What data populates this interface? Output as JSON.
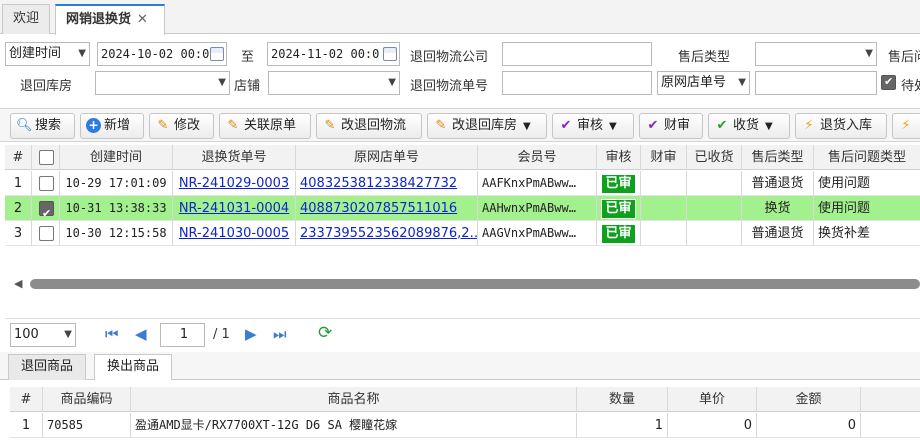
{
  "tabs": [
    {
      "label": "欢迎"
    },
    {
      "label": "网销退换货",
      "close": "✕"
    }
  ],
  "filters": {
    "date_type": "创建时间",
    "date_from": "2024-10-02 00:0",
    "to_label": "至",
    "date_to": "2024-11-02 00:0",
    "return_logistics_company_label": "退回物流公司",
    "return_logistics_company_value": "",
    "after_sale_type_label": "售后类型",
    "after_sale_type_value": "",
    "after_sale_issue_label": "售后问",
    "return_warehouse_label": "退回库房",
    "return_warehouse_value": "",
    "store_label": "店铺",
    "store_value": "",
    "return_tracking_no_label": "退回物流单号",
    "return_tracking_no_value": "",
    "order_no_type": "原网店单号",
    "order_no_value": "",
    "pending_label": "待处"
  },
  "toolbar": {
    "search": "搜索",
    "add": "新增",
    "edit": "修改",
    "link_order": "关联原单",
    "change_return_logistics": "改退回物流",
    "change_return_warehouse": "改退回库房",
    "audit": "审核",
    "finance_audit": "财审",
    "receive": "收货",
    "return_stock_in": "退货入库"
  },
  "grid": {
    "columns": [
      "#",
      "",
      "创建时间",
      "退换货单号",
      "原网店单号",
      "会员号",
      "审核",
      "财审",
      "已收货",
      "售后类型",
      "售后问题类型"
    ],
    "rows": [
      {
        "idx": "1",
        "checked": false,
        "created": "10-29 17:01:09",
        "return_no": "NR-241029-0003",
        "order_no": "4083253812338427732",
        "member": "AAFKnxPmABww…",
        "audit": "已审",
        "finance": "",
        "received": "",
        "type": "普通退货",
        "issue": "使用问题",
        "selected": false
      },
      {
        "idx": "2",
        "checked": true,
        "created": "10-31 13:38:33",
        "return_no": "NR-241031-0004",
        "order_no": "4088730207857511016",
        "member": "AAHwnxPmABww…",
        "audit": "已审",
        "finance": "",
        "received": "",
        "type": "换货",
        "issue": "使用问题",
        "selected": true
      },
      {
        "idx": "3",
        "checked": false,
        "created": "10-30 12:15:58",
        "return_no": "NR-241030-0005",
        "order_no": "2337395523562089876,2…",
        "member": "AAGVnxPmABww…",
        "audit": "已审",
        "finance": "",
        "received": "",
        "type": "普通退货",
        "issue": "换货补差",
        "selected": false
      }
    ]
  },
  "pager": {
    "page_size": "100",
    "page": "1",
    "total": "/ 1"
  },
  "subtabs": [
    {
      "label": "退回商品"
    },
    {
      "label": "换出商品"
    }
  ],
  "grid2": {
    "columns": [
      "#",
      "商品编码",
      "商品名称",
      "数量",
      "单价",
      "金额"
    ],
    "rows": [
      {
        "idx": "1",
        "code": "70585",
        "name": "盈通AMD显卡/RX7700XT-12G D6 SA 樱瞳花嫁",
        "qty": "1",
        "price": "0",
        "amount": "0"
      }
    ]
  },
  "colors": {
    "selected_row": "#a3f18e",
    "audit_badge": "#10a020",
    "link": "#1024c8",
    "accent": "#2e7bd6"
  }
}
